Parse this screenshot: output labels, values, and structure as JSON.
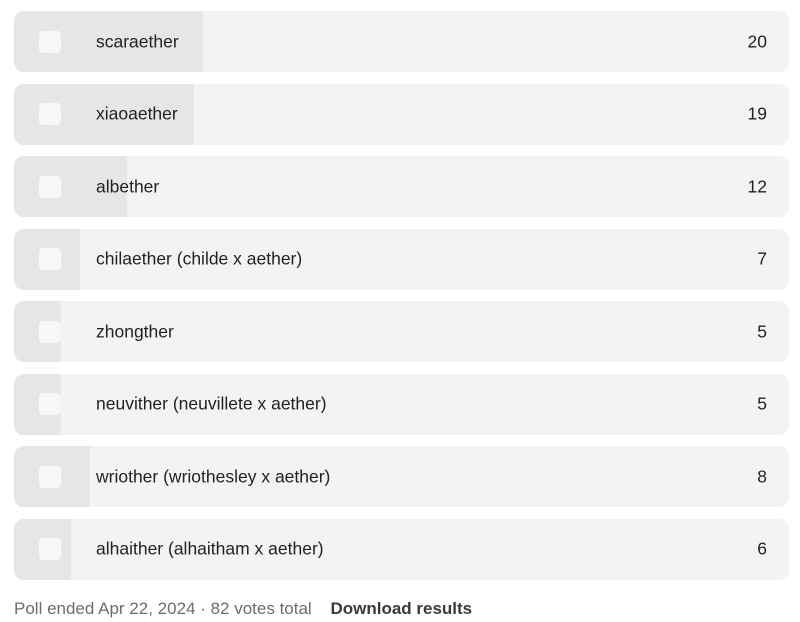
{
  "poll": {
    "total_votes": 82,
    "options": [
      {
        "label": "scaraether",
        "count": "20",
        "votes": 20
      },
      {
        "label": "xiaoaether",
        "count": "19",
        "votes": 19
      },
      {
        "label": "albether",
        "count": "12",
        "votes": 12
      },
      {
        "label": "chilaether (childe x aether)",
        "count": "7",
        "votes": 7
      },
      {
        "label": "zhongther",
        "count": "5",
        "votes": 5
      },
      {
        "label": "neuvither (neuvillete x aether)",
        "count": "5",
        "votes": 5
      },
      {
        "label": "wriother (wriothesley x aether)",
        "count": "8",
        "votes": 8
      },
      {
        "label": "alhaither (alhaitham x aether)",
        "count": "6",
        "votes": 6
      }
    ]
  },
  "footer": {
    "status": "Poll ended Apr 22, 2024 · 82 votes total",
    "download_label": "Download results"
  },
  "colors": {
    "option_background": "#f3f3f3",
    "result_fill": "#e6e6e6",
    "checkbox": "#f7f7f7",
    "muted_text": "#6d6d6d"
  }
}
